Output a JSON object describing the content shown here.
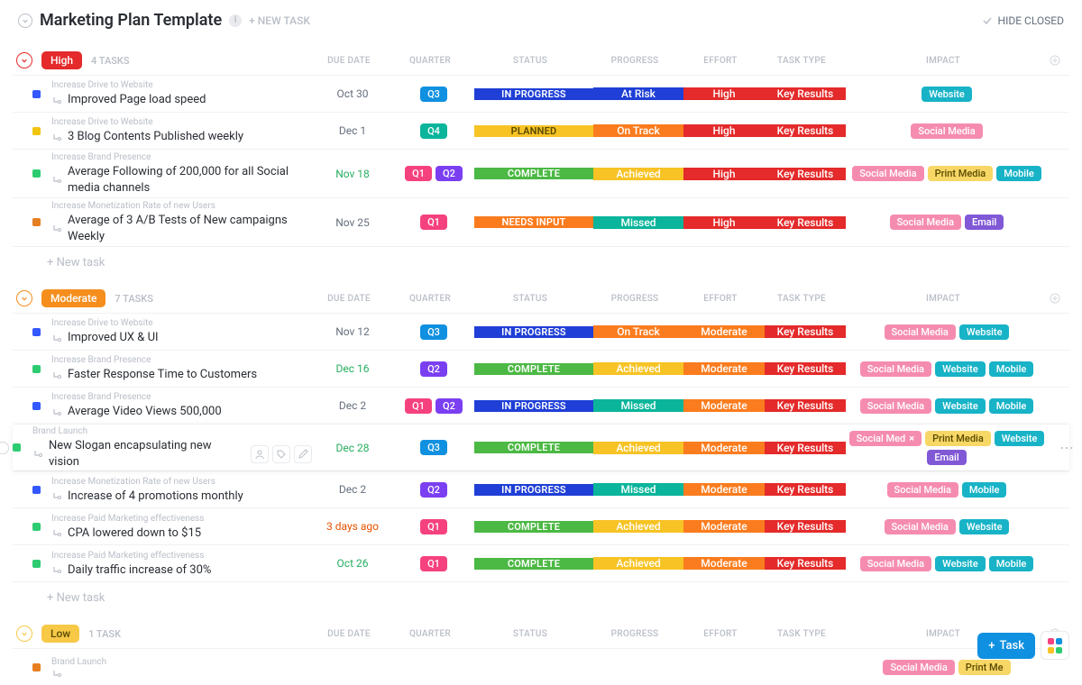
{
  "header": {
    "title": "Marketing Plan Template",
    "new_task": "+ NEW TASK",
    "hide_closed": "HIDE CLOSED"
  },
  "columns": {
    "due": "DUE DATE",
    "quarter": "QUARTER",
    "status": "STATUS",
    "progress": "PROGRESS",
    "effort": "EFFORT",
    "task_type": "TASK TYPE",
    "impact": "IMPACT"
  },
  "colors": {
    "high": "#e42a2a",
    "moderate": "#f58e1d",
    "low": "#f7c947",
    "q1": "#f5427e",
    "q2": "#7b3ff2",
    "q3": "#1090e0",
    "q4": "#0ab59b",
    "blue_status": "#1f3fd6",
    "green_status": "#4cb944",
    "yellow_status": "#f7c325",
    "orange_status": "#fb7c1e",
    "teal_status": "#0ab59b",
    "red_cell": "#e42a2a",
    "tag_pink": "#f58cb0",
    "tag_teal": "#18b3c7",
    "tag_yellow": "#f7d766",
    "tag_purple": "#8159d6",
    "status_blue_sq": "#3358ff",
    "status_green_sq": "#2ecc71",
    "status_yellow_sq": "#f1c40f",
    "status_orange_sq": "#e67e22"
  },
  "groups": [
    {
      "name": "High",
      "color_key": "high",
      "task_count": "4 TASKS",
      "tasks": [
        {
          "category": "Increase Drive to Website",
          "title": "Improved Page load speed",
          "sq": "status_blue_sq",
          "due": "Oct 30",
          "due_style": "",
          "quarters": [
            {
              "t": "Q3",
              "c": "q3"
            }
          ],
          "status": {
            "t": "IN PROGRESS",
            "c": "blue_status"
          },
          "progress": {
            "t": "At Risk",
            "c": "blue_status"
          },
          "effort": {
            "t": "High",
            "c": "red_cell"
          },
          "task_type": {
            "t": "Key Results",
            "c": "red_cell"
          },
          "impact": [
            {
              "t": "Website",
              "c": "tag_teal"
            }
          ]
        },
        {
          "category": "Increase Drive to Website",
          "title": "3 Blog Contents Published weekly",
          "sq": "status_yellow_sq",
          "due": "Dec 1",
          "due_style": "",
          "quarters": [
            {
              "t": "Q4",
              "c": "q4"
            }
          ],
          "status": {
            "t": "PLANNED",
            "c": "yellow_status"
          },
          "progress": {
            "t": "On Track",
            "c": "orange_status"
          },
          "effort": {
            "t": "High",
            "c": "red_cell"
          },
          "task_type": {
            "t": "Key Results",
            "c": "red_cell"
          },
          "impact": [
            {
              "t": "Social Media",
              "c": "tag_pink"
            }
          ]
        },
        {
          "category": "Increase Brand Presence",
          "title": "Average Following of 200,000 for all Social media channels",
          "sq": "status_green_sq",
          "due": "Nov 18",
          "due_style": "green",
          "wide": true,
          "quarters": [
            {
              "t": "Q1",
              "c": "q1"
            },
            {
              "t": "Q2",
              "c": "q2"
            }
          ],
          "status": {
            "t": "COMPLETE",
            "c": "green_status"
          },
          "progress": {
            "t": "Achieved",
            "c": "yellow_status"
          },
          "effort": {
            "t": "High",
            "c": "red_cell"
          },
          "task_type": {
            "t": "Key Results",
            "c": "red_cell"
          },
          "impact": [
            {
              "t": "Social Media",
              "c": "tag_pink"
            },
            {
              "t": "Print Media",
              "c": "tag_yellow",
              "dark": true
            },
            {
              "t": "Mobile",
              "c": "tag_teal"
            }
          ]
        },
        {
          "category": "Increase Monetization Rate of new Users",
          "title": "Average of 3 A/B Tests of New campaigns Weekly",
          "sq": "status_orange_sq",
          "due": "Nov 25",
          "due_style": "",
          "wide": true,
          "quarters": [
            {
              "t": "Q1",
              "c": "q1"
            }
          ],
          "status": {
            "t": "NEEDS INPUT",
            "c": "orange_status"
          },
          "progress": {
            "t": "Missed",
            "c": "teal_status"
          },
          "effort": {
            "t": "High",
            "c": "red_cell"
          },
          "task_type": {
            "t": "Key Results",
            "c": "red_cell"
          },
          "impact": [
            {
              "t": "Social Media",
              "c": "tag_pink"
            },
            {
              "t": "Email",
              "c": "tag_purple"
            }
          ]
        }
      ],
      "new_task": "+ New task"
    },
    {
      "name": "Moderate",
      "color_key": "moderate",
      "task_count": "7 TASKS",
      "tasks": [
        {
          "category": "Increase Drive to Website",
          "title": "Improved UX & UI",
          "sq": "status_blue_sq",
          "due": "Nov 12",
          "due_style": "",
          "quarters": [
            {
              "t": "Q3",
              "c": "q3"
            }
          ],
          "status": {
            "t": "IN PROGRESS",
            "c": "blue_status"
          },
          "progress": {
            "t": "On Track",
            "c": "orange_status"
          },
          "effort": {
            "t": "Moderate",
            "c": "orange_status"
          },
          "task_type": {
            "t": "Key Results",
            "c": "red_cell"
          },
          "impact": [
            {
              "t": "Social Media",
              "c": "tag_pink"
            },
            {
              "t": "Website",
              "c": "tag_teal"
            }
          ]
        },
        {
          "category": "Increase Brand Presence",
          "title": "Faster Response Time to Customers",
          "sq": "status_green_sq",
          "due": "Dec 16",
          "due_style": "green",
          "quarters": [
            {
              "t": "Q2",
              "c": "q2"
            }
          ],
          "status": {
            "t": "COMPLETE",
            "c": "green_status"
          },
          "progress": {
            "t": "Achieved",
            "c": "yellow_status"
          },
          "effort": {
            "t": "Moderate",
            "c": "orange_status"
          },
          "task_type": {
            "t": "Key Results",
            "c": "red_cell"
          },
          "impact": [
            {
              "t": "Social Media",
              "c": "tag_pink"
            },
            {
              "t": "Website",
              "c": "tag_teal"
            },
            {
              "t": "Mobile",
              "c": "tag_teal"
            }
          ]
        },
        {
          "category": "Increase Brand Presence",
          "title": "Average Video Views 500,000",
          "sq": "status_blue_sq",
          "due": "Dec 2",
          "due_style": "",
          "quarters": [
            {
              "t": "Q1",
              "c": "q1"
            },
            {
              "t": "Q2",
              "c": "q2"
            }
          ],
          "status": {
            "t": "IN PROGRESS",
            "c": "blue_status"
          },
          "progress": {
            "t": "Missed",
            "c": "teal_status"
          },
          "effort": {
            "t": "Moderate",
            "c": "orange_status"
          },
          "task_type": {
            "t": "Key Results",
            "c": "red_cell"
          },
          "impact": [
            {
              "t": "Social Media",
              "c": "tag_pink"
            },
            {
              "t": "Website",
              "c": "tag_teal"
            },
            {
              "t": "Mobile",
              "c": "tag_teal"
            }
          ]
        },
        {
          "category": "Brand Launch",
          "title": "New Slogan encapsulating new vision",
          "sq": "status_green_sq",
          "due": "Dec 28",
          "due_style": "green",
          "hover": true,
          "actions": true,
          "quarters": [
            {
              "t": "Q3",
              "c": "q3"
            }
          ],
          "status": {
            "t": "COMPLETE",
            "c": "green_status"
          },
          "progress": {
            "t": "Achieved",
            "c": "yellow_status"
          },
          "effort": {
            "t": "Moderate",
            "c": "orange_status"
          },
          "task_type": {
            "t": "Key Results",
            "c": "red_cell"
          },
          "impact": [
            {
              "t": "Social Med",
              "c": "tag_pink",
              "x": true
            },
            {
              "t": "Print Media",
              "c": "tag_yellow",
              "dark": true
            },
            {
              "t": "Website",
              "c": "tag_teal"
            },
            {
              "t": "Email",
              "c": "tag_purple"
            }
          ]
        },
        {
          "category": "Increase Monetization Rate of new Users",
          "title": "Increase of 4 promotions monthly",
          "sq": "status_blue_sq",
          "due": "Dec 2",
          "due_style": "",
          "quarters": [
            {
              "t": "Q2",
              "c": "q2"
            }
          ],
          "status": {
            "t": "IN PROGRESS",
            "c": "blue_status"
          },
          "progress": {
            "t": "Missed",
            "c": "teal_status"
          },
          "effort": {
            "t": "Moderate",
            "c": "orange_status"
          },
          "task_type": {
            "t": "Key Results",
            "c": "red_cell"
          },
          "impact": [
            {
              "t": "Social Media",
              "c": "tag_pink"
            },
            {
              "t": "Mobile",
              "c": "tag_teal"
            }
          ]
        },
        {
          "category": "Increase Paid Marketing effectiveness",
          "title": "CPA lowered down to $15",
          "sq": "status_green_sq",
          "due": "3 days ago",
          "due_style": "past",
          "quarters": [
            {
              "t": "Q1",
              "c": "q1"
            }
          ],
          "status": {
            "t": "COMPLETE",
            "c": "green_status"
          },
          "progress": {
            "t": "Achieved",
            "c": "yellow_status"
          },
          "effort": {
            "t": "Moderate",
            "c": "orange_status"
          },
          "task_type": {
            "t": "Key Results",
            "c": "red_cell"
          },
          "impact": [
            {
              "t": "Social Media",
              "c": "tag_pink"
            },
            {
              "t": "Website",
              "c": "tag_teal"
            }
          ]
        },
        {
          "category": "Increase Paid Marketing effectiveness",
          "title": "Daily traffic increase of 30%",
          "sq": "status_green_sq",
          "due": "Oct 26",
          "due_style": "green",
          "quarters": [
            {
              "t": "Q1",
              "c": "q1"
            }
          ],
          "status": {
            "t": "COMPLETE",
            "c": "green_status"
          },
          "progress": {
            "t": "Achieved",
            "c": "yellow_status"
          },
          "effort": {
            "t": "Moderate",
            "c": "orange_status"
          },
          "task_type": {
            "t": "Key Results",
            "c": "red_cell"
          },
          "impact": [
            {
              "t": "Social Media",
              "c": "tag_pink"
            },
            {
              "t": "Website",
              "c": "tag_teal"
            },
            {
              "t": "Mobile",
              "c": "tag_teal"
            }
          ]
        }
      ],
      "new_task": "+ New task"
    },
    {
      "name": "Low",
      "color_key": "low",
      "task_count": "1 TASK",
      "tasks": [
        {
          "category": "Brand Launch",
          "title": "",
          "sq": "status_orange_sq",
          "due": "",
          "due_style": "",
          "partial": true,
          "quarters": [],
          "status": {
            "t": "",
            "c": "orange_status"
          },
          "progress": {
            "t": "",
            "c": "orange_status"
          },
          "effort": {
            "t": "",
            "c": "yellow_status"
          },
          "task_type": {
            "t": "",
            "c": "red_cell"
          },
          "impact": [
            {
              "t": "Social Media",
              "c": "tag_pink"
            },
            {
              "t": "Print Me",
              "c": "tag_yellow",
              "dark": true
            }
          ]
        }
      ]
    }
  ],
  "fab": {
    "task": "Task"
  }
}
